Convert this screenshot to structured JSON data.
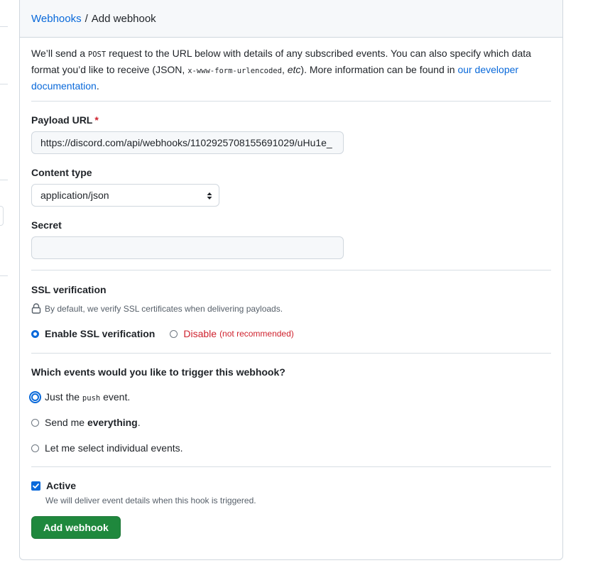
{
  "breadcrumb": {
    "parent": "Webhooks",
    "separator": "/",
    "current": "Add webhook"
  },
  "intro": {
    "part1": "We’ll send a ",
    "code1": "POST",
    "part2": " request to the URL below with details of any subscribed events. You can also specify which data format you’d like to receive (JSON, ",
    "code2": "x-www-form-urlencoded",
    "part3": ", ",
    "etc": "etc",
    "part4": "). More information can be found in ",
    "link": "our developer documentation",
    "part5": "."
  },
  "payload_url": {
    "label": "Payload URL",
    "required_mark": "*",
    "value": "https://discord.com/api/webhooks/1102925708155691029/uHu1e_"
  },
  "content_type": {
    "label": "Content type",
    "value": "application/json"
  },
  "secret": {
    "label": "Secret",
    "value": ""
  },
  "ssl": {
    "label": "SSL verification",
    "note": "By default, we verify SSL certificates when delivering payloads.",
    "enable_label": "Enable SSL verification",
    "disable_label": "Disable",
    "disable_note": "(not recommended)"
  },
  "events": {
    "question": "Which events would you like to trigger this webhook?",
    "opt1_pre": "Just the ",
    "opt1_code": "push",
    "opt1_post": " event.",
    "opt2_pre": "Send me ",
    "opt2_bold": "everything",
    "opt2_post": ".",
    "opt3": "Let me select individual events."
  },
  "active": {
    "label": "Active",
    "note": "We will deliver event details when this hook is triggered.",
    "checked": true
  },
  "submit": {
    "label": "Add webhook"
  },
  "colors": {
    "accent": "#0969da",
    "primary_button": "#1f883d",
    "danger": "#cf222e"
  }
}
